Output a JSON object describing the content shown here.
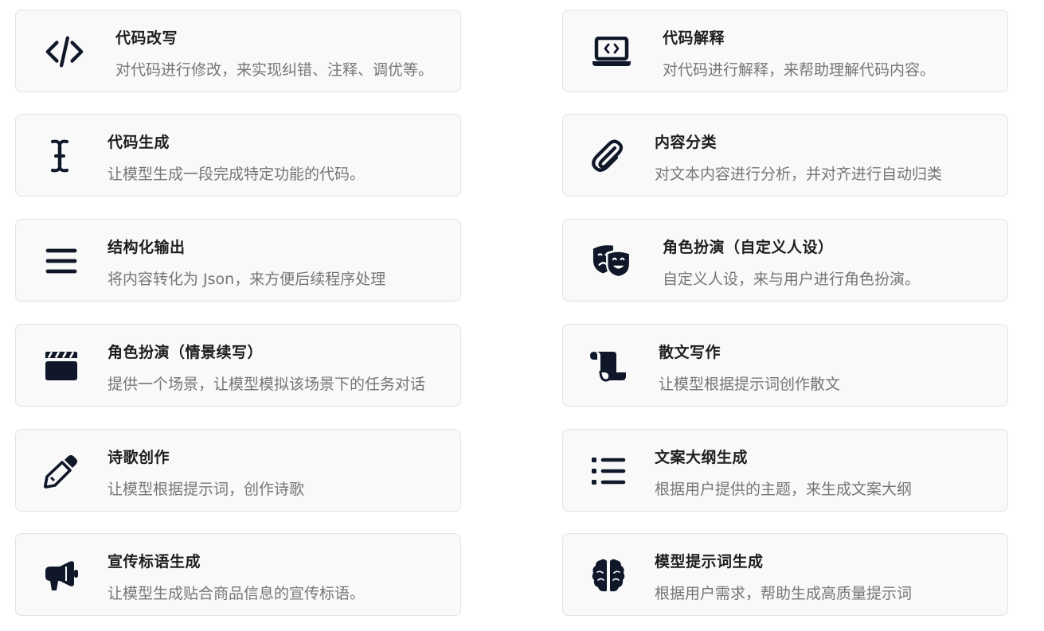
{
  "cards": [
    {
      "title": "代码改写",
      "desc": "对代码进行修改，来实现纠错、注释、调优等。",
      "icon": "code-icon"
    },
    {
      "title": "代码解释",
      "desc": "对代码进行解释，来帮助理解代码内容。",
      "icon": "laptop-code-icon"
    },
    {
      "title": "代码生成",
      "desc": "让模型生成一段完成特定功能的代码。",
      "icon": "text-cursor-icon"
    },
    {
      "title": "内容分类",
      "desc": "对文本内容进行分析，并对齐进行自动归类",
      "icon": "paperclip-icon"
    },
    {
      "title": "结构化输出",
      "desc": "将内容转化为 Json，来方便后续程序处理",
      "icon": "menu-icon"
    },
    {
      "title": "角色扮演（自定义人设）",
      "desc": "自定义人设，来与用户进行角色扮演。",
      "icon": "masks-theater-icon"
    },
    {
      "title": "角色扮演（情景续写）",
      "desc": "提供一个场景，让模型模拟该场景下的任务对话",
      "icon": "clapperboard-icon"
    },
    {
      "title": "散文写作",
      "desc": "让模型根据提示词创作散文",
      "icon": "scroll-icon"
    },
    {
      "title": "诗歌创作",
      "desc": "让模型根据提示词，创作诗歌",
      "icon": "pencil-icon"
    },
    {
      "title": "文案大纲生成",
      "desc": "根据用户提供的主题，来生成文案大纲",
      "icon": "list-icon"
    },
    {
      "title": "宣传标语生成",
      "desc": "让模型生成贴合商品信息的宣传标语。",
      "icon": "bullhorn-icon"
    },
    {
      "title": "模型提示词生成",
      "desc": "根据用户需求，帮助生成高质量提示词",
      "icon": "brain-icon"
    }
  ]
}
